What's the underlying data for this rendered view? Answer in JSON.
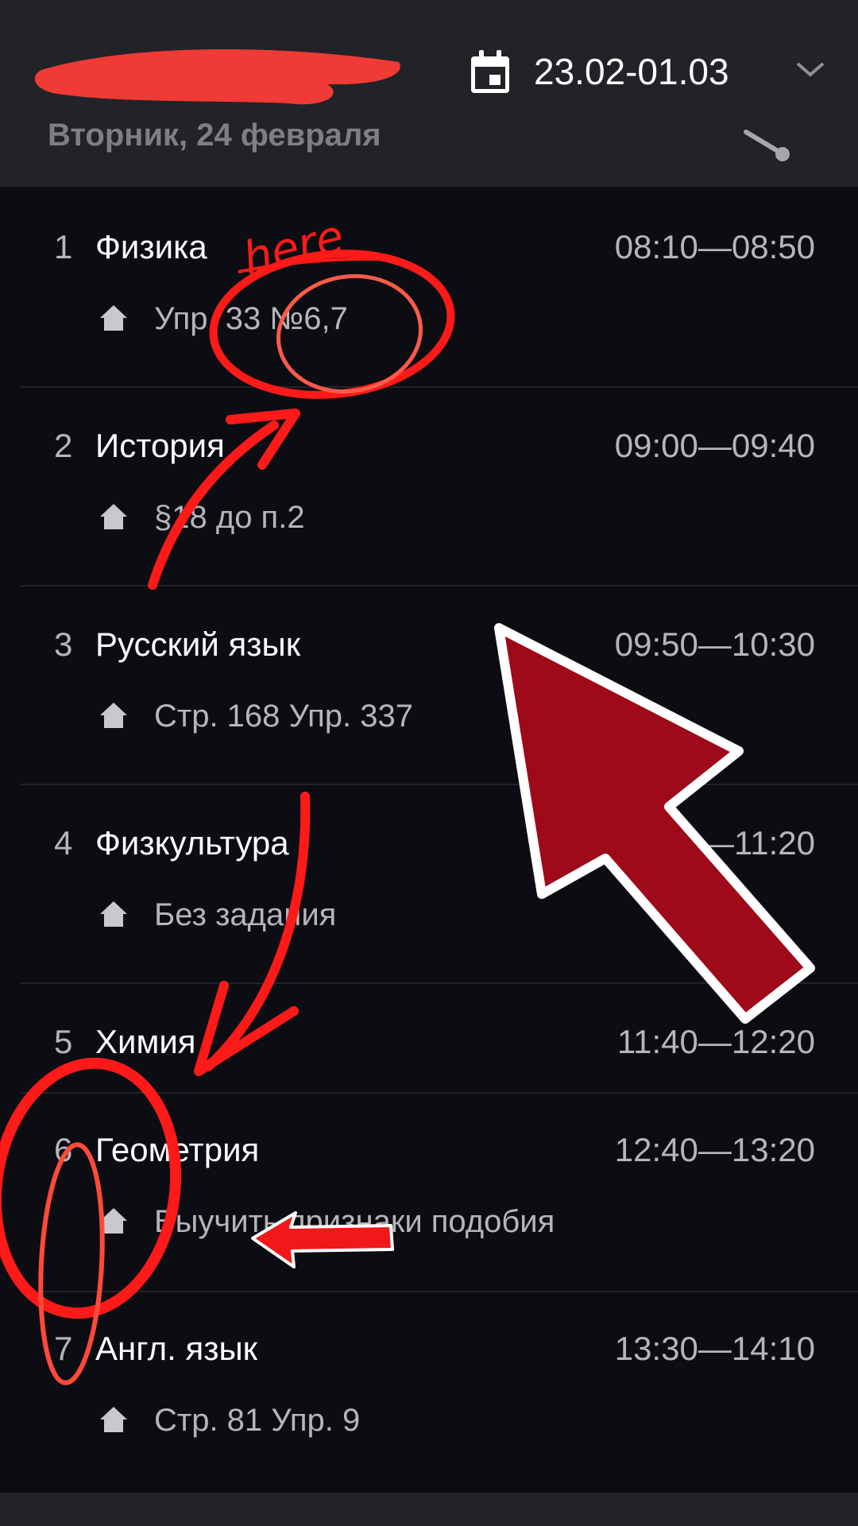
{
  "header": {
    "date_range": "23.02-01.03",
    "day_title": "Вторник, 24 февраля"
  },
  "lessons": [
    {
      "number": "1",
      "subject": "Физика",
      "time": "08:10—08:50",
      "homework": "Упр. 33 №6,7"
    },
    {
      "number": "2",
      "subject": "История",
      "time": "09:00—09:40",
      "homework": "§18 до п.2"
    },
    {
      "number": "3",
      "subject": "Русский язык",
      "time": "09:50—10:30",
      "homework": "Стр. 168 Упр. 337"
    },
    {
      "number": "4",
      "subject": "Физкультура",
      "time": "10:40—11:20",
      "homework": "Без задания"
    },
    {
      "number": "5",
      "subject": "Химия",
      "time": "11:40—12:20",
      "homework": ""
    },
    {
      "number": "6",
      "subject": "Геометрия",
      "time": "12:40—13:20",
      "homework": "Выучить признаки подобия"
    },
    {
      "number": "7",
      "subject": "Англ. язык",
      "time": "13:30—14:10",
      "homework": "Стр. 81 Упр. 9"
    }
  ],
  "annotations": {
    "here_label": "here"
  },
  "icons": {
    "calendar": "calendar-icon",
    "chevron": "chevron-down-icon",
    "collapse": "collapse-icon",
    "homework": "home-icon"
  },
  "colors": {
    "background": "#0c0d12",
    "header": "#222326",
    "annotation_red": "#ff1a1a",
    "arrow_dark_red": "#9e0a1a"
  }
}
